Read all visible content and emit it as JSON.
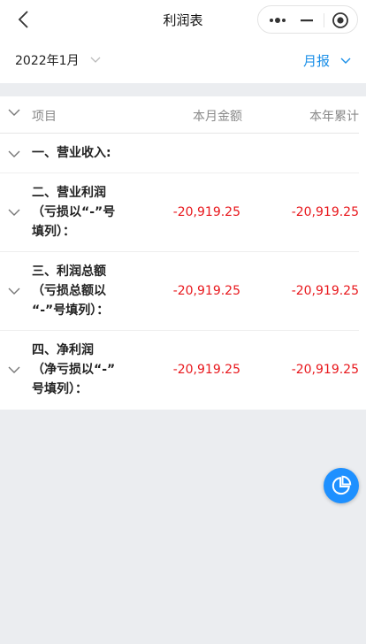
{
  "nav": {
    "title": "利润表"
  },
  "filter": {
    "date": "2022年1月",
    "period": "月报"
  },
  "table": {
    "headers": {
      "item": "项目",
      "month": "本月金额",
      "year": "本年累计"
    },
    "rows": [
      {
        "lines": [
          "一、营业收入:"
        ],
        "month": "",
        "year": ""
      },
      {
        "lines": [
          "二、营业利润",
          "（亏损以“-”号",
          "填列）："
        ],
        "month": "-20,919.25",
        "year": "-20,919.25"
      },
      {
        "lines": [
          "三、利润总额",
          "（亏损总额以",
          "“-”号填列）："
        ],
        "month": "-20,919.25",
        "year": "-20,919.25"
      },
      {
        "lines": [
          "四、净利润",
          "（净亏损以“-”",
          "号填列）："
        ],
        "month": "-20,919.25",
        "year": "-20,919.25"
      }
    ]
  },
  "colors": {
    "accent": "#1a8fe8",
    "negative": "#e8161b",
    "fab": "#1e90ff"
  }
}
